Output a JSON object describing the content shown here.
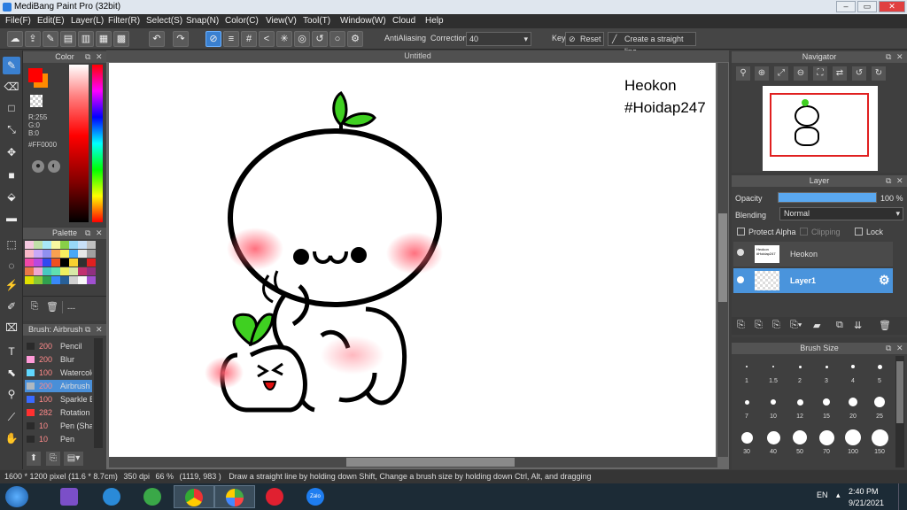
{
  "window": {
    "title": "MediBang Paint Pro (32bit)",
    "min": "–",
    "max": "▭",
    "close": "✕"
  },
  "menu": [
    "File(F)",
    "Edit(E)",
    "Layer(L)",
    "Filter(R)",
    "Select(S)",
    "Snap(N)",
    "Color(C)",
    "View(V)",
    "Tool(T)",
    "Window(W)",
    "Cloud",
    "Help"
  ],
  "toolbar": {
    "antialiasing_label": "AntiAliasing",
    "correction_label": "Correction",
    "correction_value": "40",
    "key_label": "Key",
    "reset_label": "Reset",
    "straight_line_label": "Create a straight line"
  },
  "color_panel": {
    "title": "Color",
    "r": "R:255",
    "g": "G:0",
    "b": "B:0",
    "hex": "#FF0000",
    "primary": "#ff0000",
    "secondary": "#ff8a00"
  },
  "palette_panel": {
    "title": "Palette",
    "dash": "---",
    "colors": [
      "#f4c8e0",
      "#c0e0a8",
      "#a8e8f8",
      "#f8f8a0",
      "#88d048",
      "#98d8f8",
      "#c8e0f8",
      "#c0c0c0",
      "#f8b8c8",
      "#c8a8f8",
      "#9090f0",
      "#f8a050",
      "#f8f060",
      "#48a8f8",
      "#e8e8e8",
      "#a0a0a0",
      "#f048a8",
      "#b848e0",
      "#3048f0",
      "#f05020",
      "#000000",
      "#f8d030",
      "#303030",
      "#e02020",
      "#e87848",
      "#f0a8d0",
      "#48c8c0",
      "#60e0b0",
      "#f0f060",
      "#d8e8a8",
      "#c03070",
      "#903080",
      "#e0e000",
      "#88c838",
      "#30a050",
      "#3888f8",
      "#286098",
      "#d0d0d0",
      "#f8f8f8",
      "#a050d0"
    ]
  },
  "brush_panel": {
    "title": "Brush: Airbrush",
    "items": [
      {
        "size": "200",
        "name": "Pencil",
        "color": "#2a2a2a"
      },
      {
        "size": "200",
        "name": "Blur",
        "color": "#ff9ad8"
      },
      {
        "size": "100",
        "name": "Watercolor",
        "color": "#60d8ff"
      },
      {
        "size": "200",
        "name": "Airbrush",
        "color": "#b0b8c0"
      },
      {
        "size": "100",
        "name": "Sparkle Brush",
        "color": "#3a6aff"
      },
      {
        "size": "282",
        "name": "Rotation",
        "color": "#ff3030"
      },
      {
        "size": "10",
        "name": "Pen (Sharp)",
        "color": "#2a2a2a"
      },
      {
        "size": "10",
        "name": "Pen",
        "color": "#2a2a2a"
      }
    ]
  },
  "canvas": {
    "tab_title": "Untitled",
    "text_line1": "Heokon",
    "text_line2": "#Hoidap247"
  },
  "navigator": {
    "title": "Navigator"
  },
  "layer_panel": {
    "title": "Layer",
    "opacity_label": "Opacity",
    "opacity_value": "100 %",
    "opacity_fraction": 1.0,
    "blending_label": "Blending",
    "blending_value": "Normal",
    "protect_alpha": "Protect Alpha",
    "clipping": "Clipping",
    "lock": "Lock",
    "layers": [
      {
        "name": "Heokon",
        "selected": false,
        "thumb_text": "Heokon #Hoidap247"
      },
      {
        "name": "Layer1",
        "selected": true
      }
    ]
  },
  "brush_size_panel": {
    "title": "Brush Size",
    "sizes": [
      "1",
      "1.5",
      "2",
      "3",
      "4",
      "5",
      "7",
      "10",
      "12",
      "15",
      "20",
      "25",
      "30",
      "40",
      "50",
      "70",
      "100",
      "150"
    ]
  },
  "status": {
    "pixel_size": "1600 * 1200 pixel",
    "cm_size": "(11.6 * 8.7cm)",
    "dpi": "350 dpi",
    "zoom": "66 %",
    "coords": "(1119, 983 )",
    "hint": "Draw a straight line by holding down Shift, Change a brush size by holding down Ctrl, Alt, and dragging"
  },
  "taskbar": {
    "lang": "EN",
    "time": "2:40 PM",
    "date": "9/21/2021",
    "zalo": "Zalo"
  }
}
